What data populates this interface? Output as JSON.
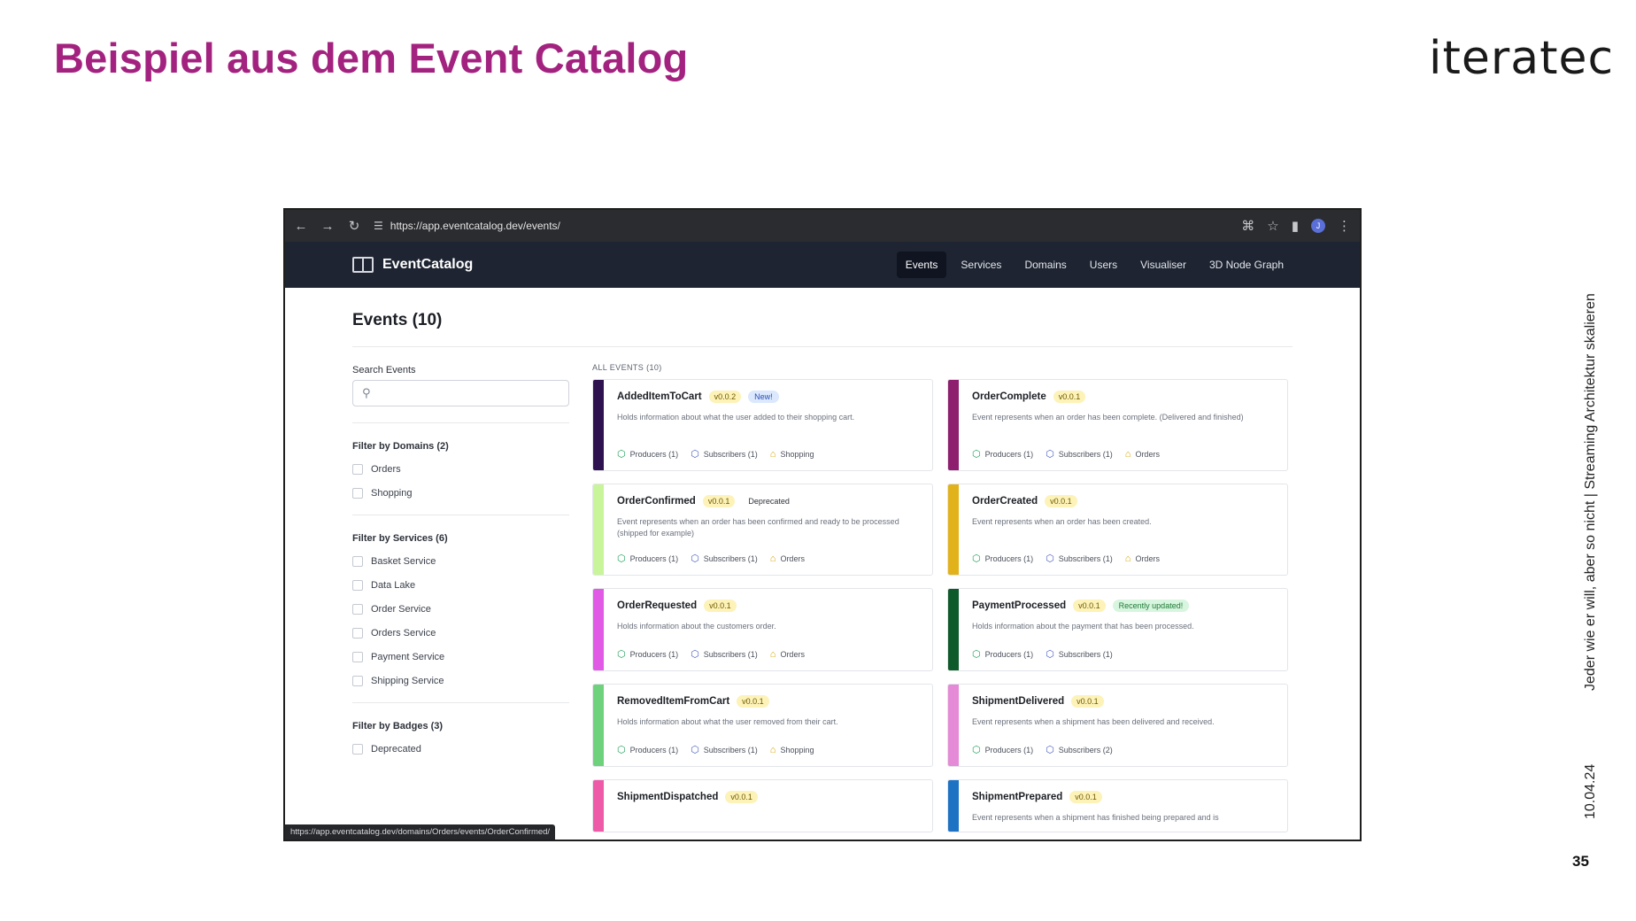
{
  "slide": {
    "title": "Beispiel aus dem Event Catalog",
    "logo": "iteratec",
    "side_text": "Jeder wie er will, aber so nicht | Streaming Architektur skalieren",
    "date": "10.04.24",
    "page_number": "35"
  },
  "browser": {
    "url": "https://app.eventcatalog.dev/events/",
    "status_url": "https://app.eventcatalog.dev/domains/Orders/events/OrderConfirmed/",
    "avatar_letter": "J"
  },
  "app": {
    "brand": "EventCatalog",
    "nav": [
      "Events",
      "Services",
      "Domains",
      "Users",
      "Visualiser",
      "3D Node Graph"
    ],
    "active_nav": "Events",
    "page_heading": "Events (10)",
    "search_label": "Search Events",
    "all_events_label": "ALL EVENTS (10)"
  },
  "filters": {
    "domains": {
      "title": "Filter by Domains (2)",
      "items": [
        "Orders",
        "Shopping"
      ]
    },
    "services": {
      "title": "Filter by Services (6)",
      "items": [
        "Basket Service",
        "Data Lake",
        "Order Service",
        "Orders Service",
        "Payment Service",
        "Shipping Service"
      ]
    },
    "badges": {
      "title": "Filter by Badges (3)",
      "items": [
        "Deprecated"
      ]
    }
  },
  "events": [
    {
      "name": "AddedItemToCart",
      "version": "v0.0.2",
      "tag": "New!",
      "tag_type": "new",
      "color": "#2e1250",
      "desc": "Holds information about what the user added to their shopping cart.",
      "producers": "Producers (1)",
      "subscribers": "Subscribers (1)",
      "domain": "Shopping"
    },
    {
      "name": "OrderComplete",
      "version": "v0.0.1",
      "tag": "",
      "tag_type": "",
      "color": "#8e1e6e",
      "desc": "Event represents when an order has been complete. (Delivered and finished)",
      "producers": "Producers (1)",
      "subscribers": "Subscribers (1)",
      "domain": "Orders"
    },
    {
      "name": "OrderConfirmed",
      "version": "v0.0.1",
      "tag": "Deprecated",
      "tag_type": "dep",
      "color": "#c9f59a",
      "desc": "Event represents when an order has been confirmed and ready to be processed (shipped for example)",
      "producers": "Producers (1)",
      "subscribers": "Subscribers (1)",
      "domain": "Orders"
    },
    {
      "name": "OrderCreated",
      "version": "v0.0.1",
      "tag": "",
      "tag_type": "",
      "color": "#e2b21a",
      "desc": "Event represents when an order has been created.",
      "producers": "Producers (1)",
      "subscribers": "Subscribers (1)",
      "domain": "Orders"
    },
    {
      "name": "OrderRequested",
      "version": "v0.0.1",
      "tag": "",
      "tag_type": "",
      "color": "#e05ae6",
      "desc": "Holds information about the customers order.",
      "producers": "Producers (1)",
      "subscribers": "Subscribers (1)",
      "domain": "Orders"
    },
    {
      "name": "PaymentProcessed",
      "version": "v0.0.1",
      "tag": "Recently updated!",
      "tag_type": "upd",
      "color": "#0f5a2a",
      "desc": "Holds information about the payment that has been processed.",
      "producers": "Producers (1)",
      "subscribers": "Subscribers (1)",
      "domain": ""
    },
    {
      "name": "RemovedItemFromCart",
      "version": "v0.0.1",
      "tag": "",
      "tag_type": "",
      "color": "#6ed27c",
      "desc": "Holds information about what the user removed from their cart.",
      "producers": "Producers (1)",
      "subscribers": "Subscribers (1)",
      "domain": "Shopping"
    },
    {
      "name": "ShipmentDelivered",
      "version": "v0.0.1",
      "tag": "",
      "tag_type": "",
      "color": "#e58ad6",
      "desc": "Event represents when a shipment has been delivered and received.",
      "producers": "Producers (1)",
      "subscribers": "Subscribers (2)",
      "domain": ""
    },
    {
      "name": "ShipmentDispatched",
      "version": "v0.0.1",
      "tag": "",
      "tag_type": "",
      "color": "#ef5aa8",
      "desc": "",
      "producers": "",
      "subscribers": "",
      "domain": ""
    },
    {
      "name": "ShipmentPrepared",
      "version": "v0.0.1",
      "tag": "",
      "tag_type": "",
      "color": "#1e72c4",
      "desc": "Event represents when a shipment has finished being prepared and is",
      "producers": "",
      "subscribers": "",
      "domain": ""
    }
  ]
}
